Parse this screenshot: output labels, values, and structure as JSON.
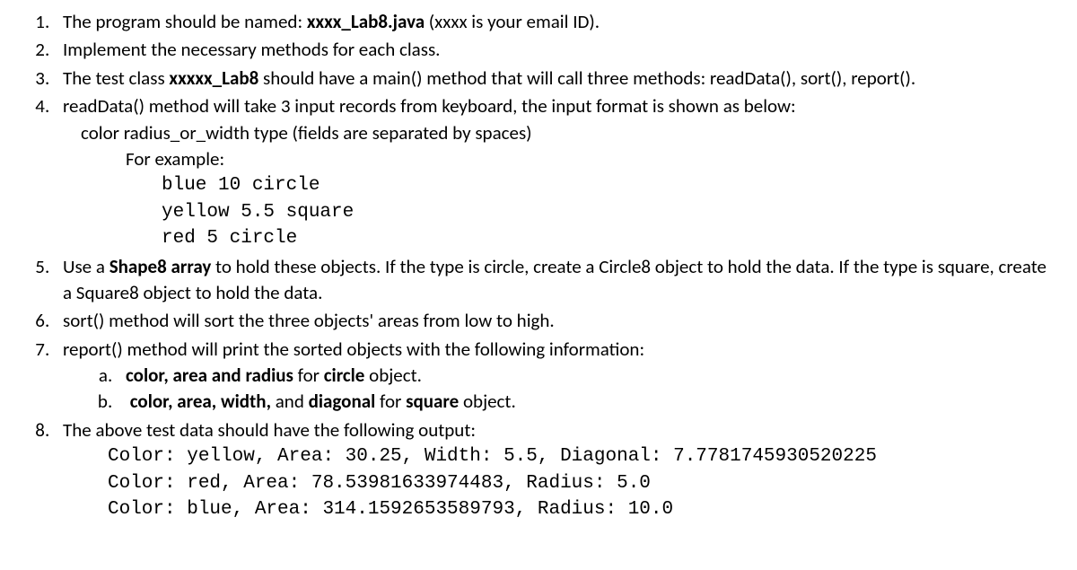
{
  "items": {
    "i1_prefix": "The program should be named: ",
    "i1_bold": "xxxx_Lab8.java",
    "i1_suffix": " (xxxx is your email ID).",
    "i2": "Implement the necessary methods for each class.",
    "i3_prefix": "The test class ",
    "i3_bold": "xxxxx_Lab8",
    "i3_suffix": " should have a main() method that will call three methods: readData(), sort(), report().",
    "i4_main": "readData() method will take 3 input records from keyboard, the input format is shown as below:",
    "i4_format": "color  radius_or_width  type  (fields are separated by spaces)",
    "i4_example_label": "For example:",
    "i4_example_lines": {
      "l1": "blue 10 circle",
      "l2": "yellow 5.5 square",
      "l3": "red 5 circle"
    },
    "i5_prefix": "Use a ",
    "i5_bold": "Shape8 array",
    "i5_suffix": " to hold these objects. If the type is circle, create a Circle8 object to hold the data. If the type is square, create a Square8 object to hold the data.",
    "i6": "sort() method will sort the three objects' areas from low to high.",
    "i7_main": "report() method will print the sorted objects with the following information:",
    "i7a_b1": "color, area and radius",
    "i7a_mid": " for ",
    "i7a_b2": "circle",
    "i7a_suffix": " object.",
    "i7b_b1": "color, area, width,",
    "i7b_mid1": " and ",
    "i7b_b2": "diagonal",
    "i7b_mid2": " for ",
    "i7b_b3": "square",
    "i7b_suffix": " object.",
    "i8_main": "The above test data should have the following output:",
    "i8_output": {
      "l1": "Color: yellow, Area: 30.25, Width: 5.5, Diagonal: 7.7781745930520225",
      "l2": "Color: red, Area: 78.53981633974483, Radius: 5.0",
      "l3": "Color: blue, Area: 314.1592653589793, Radius: 10.0"
    }
  }
}
